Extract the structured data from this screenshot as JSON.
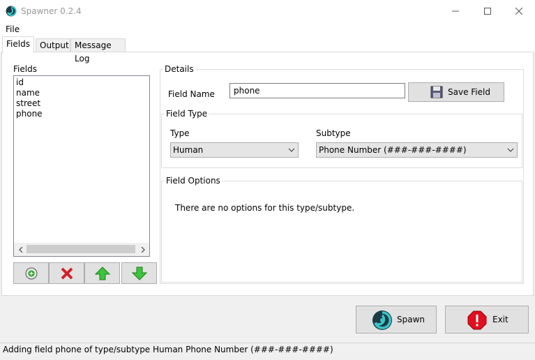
{
  "window": {
    "title": "Spawner 0.2.4"
  },
  "menu": {
    "file": "File"
  },
  "tabs": [
    {
      "label": "Fields"
    },
    {
      "label": "Output"
    },
    {
      "label": "Message Log"
    }
  ],
  "fields_panel": {
    "label": "Fields",
    "items": [
      "id",
      "name",
      "street",
      "phone"
    ]
  },
  "details": {
    "group_label": "Details",
    "field_name_label": "Field Name",
    "field_name_value": "phone",
    "save_button": "Save Field",
    "field_type": {
      "group_label": "Field Type",
      "type_label": "Type",
      "type_value": "Human",
      "subtype_label": "Subtype",
      "subtype_value": "Phone Number (###-###-####)"
    },
    "field_options": {
      "group_label": "Field Options",
      "message": "There are no options for this type/subtype."
    }
  },
  "actions": {
    "spawn_button": "Spawn",
    "exit_button": "Exit"
  },
  "status": {
    "text": "Adding field phone of type/subtype Human Phone Number (###-###-####)"
  },
  "colors": {
    "accent_green": "#2aa52a",
    "delete_red": "#d0202a",
    "exit_red": "#e01020",
    "spawn_teal": "#20a0a8"
  }
}
